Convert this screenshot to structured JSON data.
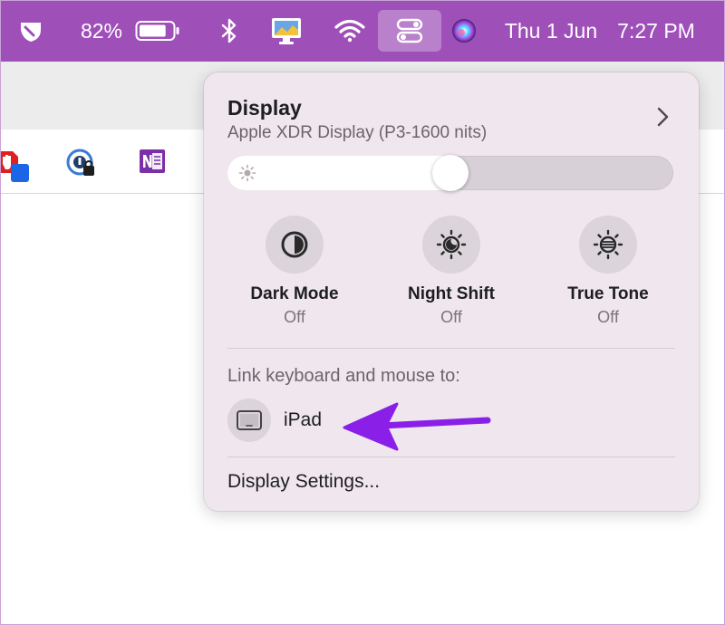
{
  "menubar": {
    "battery_percent": "82%",
    "battery_level": 0.82,
    "date": "Thu 1 Jun",
    "time": "7:27 PM",
    "bg_color": "#9f4fb8",
    "icons": [
      "app-menu-icon",
      "battery-icon",
      "bluetooth-icon",
      "display-app-icon",
      "wifi-icon",
      "control-center-icon",
      "siri-icon"
    ]
  },
  "browser": {
    "extensions": [
      "adblock-icon",
      "password-manager-icon",
      "onenote-icon"
    ]
  },
  "display_panel": {
    "title": "Display",
    "subtitle": "Apple XDR Display (P3-1600 nits)",
    "brightness_level": 0.5,
    "tiles": [
      {
        "label": "Dark Mode",
        "state": "Off",
        "icon": "dark-mode-icon"
      },
      {
        "label": "Night Shift",
        "state": "Off",
        "icon": "night-shift-icon"
      },
      {
        "label": "True Tone",
        "state": "Off",
        "icon": "true-tone-icon"
      }
    ],
    "link_section_title": "Link keyboard and mouse to:",
    "device": {
      "label": "iPad",
      "icon": "ipad-icon"
    },
    "settings_link": "Display Settings...",
    "arrow_color": "#8a1fe8"
  }
}
